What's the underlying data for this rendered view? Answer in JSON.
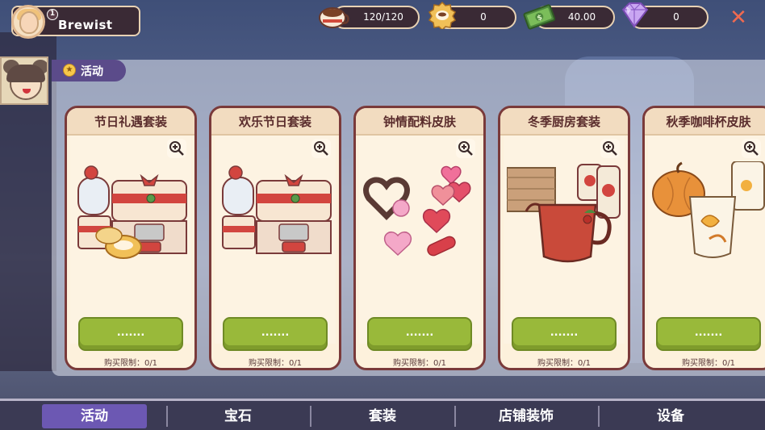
{
  "profile": {
    "name": "Brewist",
    "level": "1"
  },
  "resources": [
    {
      "icon": "coffee-cup-icon",
      "value": "120/120"
    },
    {
      "icon": "cookie-icon",
      "value": "0"
    },
    {
      "icon": "cash-icon",
      "value": "40.00"
    },
    {
      "icon": "gem-icon",
      "value": "0"
    }
  ],
  "close_label": "✕",
  "section": {
    "label": "活动"
  },
  "cards": [
    {
      "title": "节日礼遇套装",
      "button": ".......",
      "limit": "购买限制：0/1",
      "art": "espresso-machine-set"
    },
    {
      "title": "欢乐节日套装",
      "button": ".......",
      "limit": "购买限制：0/1",
      "art": "espresso-machine"
    },
    {
      "title": "钟情配料皮肤",
      "button": ".......",
      "limit": "购买限制：0/1",
      "art": "hearts-toppings"
    },
    {
      "title": "冬季厨房套装",
      "button": ".......",
      "limit": "购买限制：0/1",
      "art": "jug-and-jars"
    },
    {
      "title": "秋季咖啡杯皮肤",
      "button": ".......",
      "limit": "购买限制：0/1",
      "art": "autumn-cups"
    }
  ],
  "tabs": [
    {
      "label": "活动",
      "active": true
    },
    {
      "label": "宝石",
      "active": false
    },
    {
      "label": "套装",
      "active": false
    },
    {
      "label": "店铺装饰",
      "active": false
    },
    {
      "label": "设备",
      "active": false
    }
  ],
  "colors": {
    "accent": "#6c58b3",
    "button_green": "#99b93a",
    "card_border": "#7a3a3a",
    "close": "#f06a50"
  }
}
